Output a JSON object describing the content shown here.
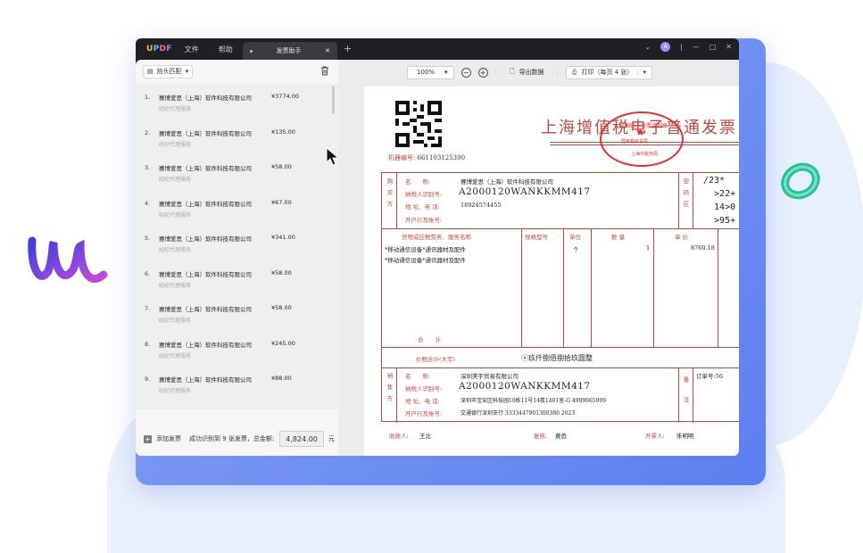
{
  "app": {
    "brand": {
      "u": "U",
      "p": "P",
      "d": "D",
      "f": "F"
    },
    "menu": [
      "文件",
      "帮助"
    ],
    "tab_label": "发票助手",
    "avatar_letter": "A"
  },
  "sidebar": {
    "match_select": "抬头匹配",
    "items": [
      {
        "num": "1.",
        "company": "赛博爱思（上海）软件科技有限公司",
        "amount": "¥3774.00",
        "service": "经纪代理服务"
      },
      {
        "num": "2.",
        "company": "赛博爱思（上海）软件科技有限公司",
        "amount": "¥135.00",
        "service": "经纪代理服务"
      },
      {
        "num": "3.",
        "company": "赛博爱思（上海）软件科技有限公司",
        "amount": "¥58.00",
        "service": "经纪代理服务"
      },
      {
        "num": "4.",
        "company": "赛博爱思（上海）软件科技有限公司",
        "amount": "¥67.00",
        "service": "经纪代理服务"
      },
      {
        "num": "5.",
        "company": "赛博爱思（上海）软件科技有限公司",
        "amount": "¥341.00",
        "service": "经纪代理服务"
      },
      {
        "num": "6.",
        "company": "赛博爱思（上海）软件科技有限公司",
        "amount": "¥58.00",
        "service": "经纪代理服务"
      },
      {
        "num": "7.",
        "company": "赛博爱思（上海）软件科技有限公司",
        "amount": "¥58.00",
        "service": "经纪代理服务"
      },
      {
        "num": "8.",
        "company": "赛博爱思（上海）软件科技有限公司",
        "amount": "¥245.00",
        "service": "经纪代理服务"
      },
      {
        "num": "9.",
        "company": "赛博爱思（上海）软件科技有限公司",
        "amount": "¥88.00",
        "service": "经纪代理服务"
      }
    ],
    "footer": {
      "add_label": "添加发票",
      "summary": "成功识别到 9 张发票，总金额:",
      "total": "4,824.00",
      "unit": "元"
    }
  },
  "toolbar": {
    "zoom": "100%",
    "export": "导出数据",
    "print": "打印（每页 4 张）"
  },
  "invoice": {
    "title": "上海增值税电子普通发票",
    "machine_label": "机器编号:",
    "machine_no": "661103125390",
    "seal": {
      "top": "全国统一发票监制章",
      "mid": "国家税务总局",
      "bottom": "上海市税务局"
    },
    "buyer_col": "购买方",
    "buyer": {
      "name_label": "名　　称:",
      "name": "赛博爱思（上海）软件科技有限公司",
      "tax_label": "纳税人识别号:",
      "tax": "A2000120WANKKMM417",
      "addr_label": "地 址、电 话:",
      "addr": "18924574455",
      "bank_label": "开户行及账号:"
    },
    "pw_col": "密码区",
    "password_lines": [
      "/23*",
      "  >22+",
      "  14>0",
      "  >95+"
    ],
    "headers": {
      "item": "货物或应税劳务、服务名称",
      "spec": "规格型号",
      "unit": "单位",
      "qty": "数 量",
      "price": "单 价"
    },
    "rows": [
      {
        "item": "*移动通信设备*通讯器材及配件",
        "unit": "个",
        "qty": "1",
        "price": "8760.18"
      },
      {
        "item": "*移动通信设备*通讯器材及配件",
        "unit": "",
        "qty": "",
        "price": ""
      }
    ],
    "total_label": "合　　计",
    "tax_total_label": "价税合计(大写)",
    "tax_total_value": "ⓧ玖仟捌佰捌拾玖圆整",
    "seller_col": "销售方",
    "seller": {
      "name_label": "名　　称:",
      "name": "深圳美宇贸易有限公司",
      "tax_label": "纳税人识别号:",
      "tax": "A2000120WANKKMM417",
      "addr_label": "地 址、电 话:",
      "addr": "深圳市宝安区科技园10栋11号14楼1401室-G 4999065999",
      "bank_label": "开户行及账号:",
      "bank": "交通银行深圳支行 3333447901300380 2023"
    },
    "remark_col": "备注",
    "order_label": "订单号:56",
    "payee_label": "收款人:",
    "payee": "王北",
    "reviewer_label": "复核:",
    "reviewer": "黄恐",
    "drawer_label": "开票人:",
    "drawer": "朱明明"
  },
  "colors": {
    "frame": "#7090f2",
    "invoice_red": "#b64b3f",
    "seal_red": "#d83434"
  }
}
